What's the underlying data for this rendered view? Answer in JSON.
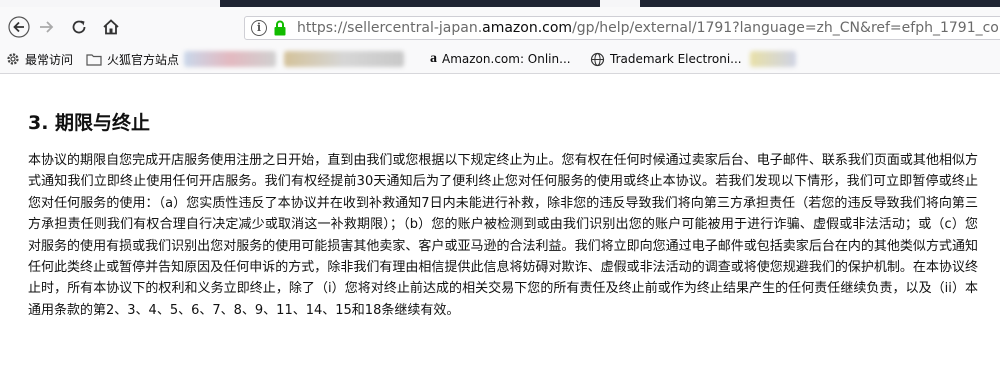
{
  "browser": {
    "url_scheme_prefix": "https://sellercentral-japan.",
    "url_host": "amazon.com",
    "url_path": "/gp/help/external/1791?language=zh_CN&ref=efph_1791_cont_20"
  },
  "bookmarks": {
    "items": [
      {
        "label": "最常访问",
        "icon": "gear-icon"
      },
      {
        "label": "火狐官方站点",
        "icon": "folder-icon"
      },
      {
        "label": "Amazon.com: Onlin...",
        "icon": "amazon-icon"
      },
      {
        "label": "Trademark Electroni...",
        "icon": "globe-icon"
      }
    ]
  },
  "article": {
    "heading": "3. 期限与终止",
    "body": "本协议的期限自您完成开店服务使用注册之日开始，直到由我们或您根据以下规定终止为止。您有权在任何时候通过卖家后台、电子邮件、联系我们页面或其他相似方式通知我们立即终止使用任何开店服务。我们有权经提前30天通知后为了便利终止您对任何服务的使用或终止本协议。若我们发现以下情形，我们可立即暂停或终止您对任何服务的使用：（a）您实质性违反了本协议并在收到补救通知7日内未能进行补救，除非您的违反导致我们将向第三方承担责任（若您的违反导致我们将向第三方承担责任则我们有权合理自行决定减少或取消这一补救期限）；（b）您的账户被检测到或由我们识别出您的账户可能被用于进行诈骗、虚假或非法活动；或（c）您对服务的使用有损或我们识别出您对服务的使用可能损害其他卖家、客户或亚马逊的合法利益。我们将立即向您通过电子邮件或包括卖家后台在内的其他类似方式通知任何此类终止或暂停并告知原因及任何申诉的方式，除非我们有理由相信提供此信息将妨碍对欺诈、虚假或非法活动的调查或将使您规避我们的保护机制。在本协议终止时，所有本协议下的权利和义务立即终止，除了（i）您将对终止前达成的相关交易下您的所有责任及终止前或作为终止结果产生的任何责任继续负责，以及（ii）本通用条款的第2、3、4、5、6、7、8、9、11、14、15和18条继续有效。"
  },
  "colors": {
    "lock_green": "#12bc00",
    "tab_dark": "#1f2433"
  }
}
